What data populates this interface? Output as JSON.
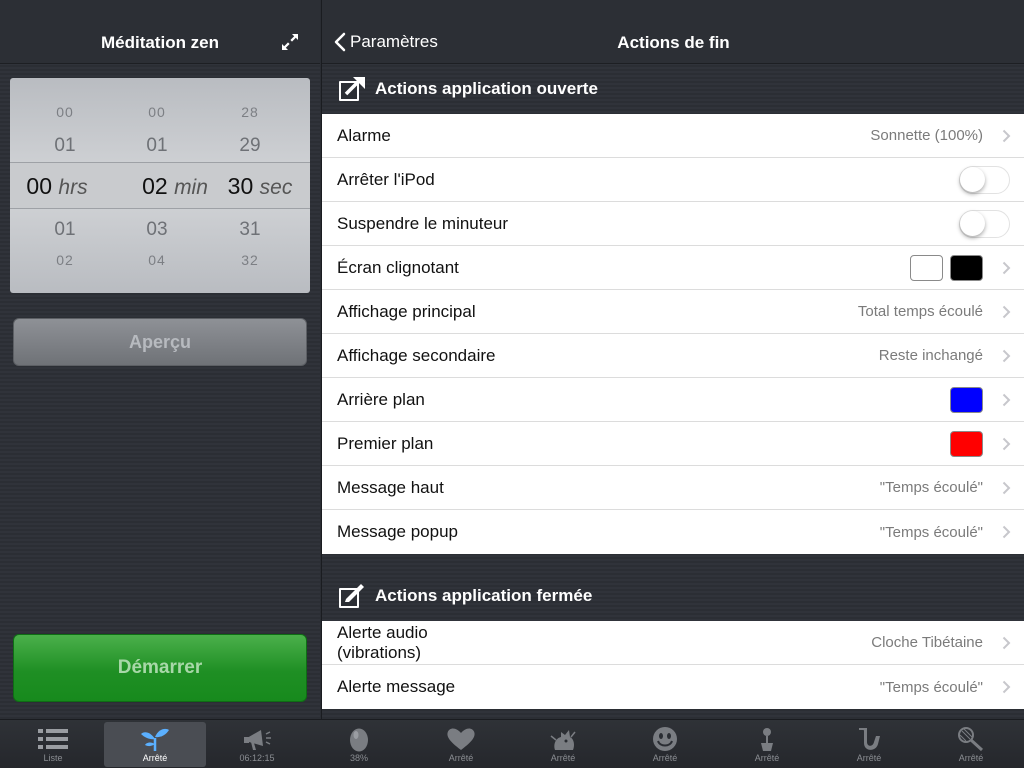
{
  "left": {
    "title": "Méditation zen",
    "picker": {
      "hours": {
        "above2": "00",
        "above1": "01",
        "selected": "00",
        "unit": "hrs",
        "below1": "01",
        "below2": "02"
      },
      "minutes": {
        "above2": "00",
        "above1": "01",
        "selected": "02",
        "unit": "min",
        "below1": "03",
        "below2": "04"
      },
      "seconds": {
        "above2": "28",
        "above1": "29",
        "selected": "30",
        "unit": "sec",
        "below1": "31",
        "below2": "32"
      }
    },
    "preview_label": "Aperçu",
    "start_label": "Démarrer"
  },
  "right": {
    "back_label": "Paramètres",
    "title": "Actions de fin",
    "section_open": {
      "title": "Actions application ouverte",
      "rows": {
        "alarme": {
          "label": "Alarme",
          "value": "Sonnette (100%)"
        },
        "ipod": {
          "label": "Arrêter l'iPod"
        },
        "suspend": {
          "label": "Suspendre le minuteur"
        },
        "flash": {
          "label": "Écran clignotant",
          "color1": "#ffffff",
          "color2": "#000000"
        },
        "main_display": {
          "label": "Affichage principal",
          "value": "Total temps écoulé"
        },
        "secondary_display": {
          "label": "Affichage secondaire",
          "value": "Reste inchangé"
        },
        "background": {
          "label": "Arrière plan",
          "color": "#0000ff"
        },
        "foreground": {
          "label": "Premier plan",
          "color": "#ff0000"
        },
        "message_top": {
          "label": "Message haut",
          "value": "\"Temps écoulé\""
        },
        "message_popup": {
          "label": "Message popup",
          "value": "\"Temps écoulé\""
        }
      }
    },
    "section_closed": {
      "title": "Actions application fermée",
      "rows": {
        "audio_alert": {
          "label_line1": "Alerte audio",
          "label_line2": "(vibrations)",
          "value": "Cloche Tibétaine"
        },
        "message_alert": {
          "label": "Alerte message",
          "value": "\"Temps écoulé\""
        }
      }
    }
  },
  "tabbar": {
    "tabs": [
      {
        "label": "Liste",
        "icon": "list-icon"
      },
      {
        "label": "Arrêté",
        "icon": "sprout-icon",
        "selected": true
      },
      {
        "label": "06:12:15",
        "icon": "megaphone-icon"
      },
      {
        "label": "38%",
        "icon": "egg-icon"
      },
      {
        "label": "Arrêté",
        "icon": "heart-icon"
      },
      {
        "label": "Arrêté",
        "icon": "creature-icon"
      },
      {
        "label": "Arrêté",
        "icon": "smiley-icon"
      },
      {
        "label": "Arrêté",
        "icon": "flowerpot-icon"
      },
      {
        "label": "Arrêté",
        "icon": "saxophone-icon"
      },
      {
        "label": "Arrêté",
        "icon": "badminton-icon"
      }
    ]
  }
}
